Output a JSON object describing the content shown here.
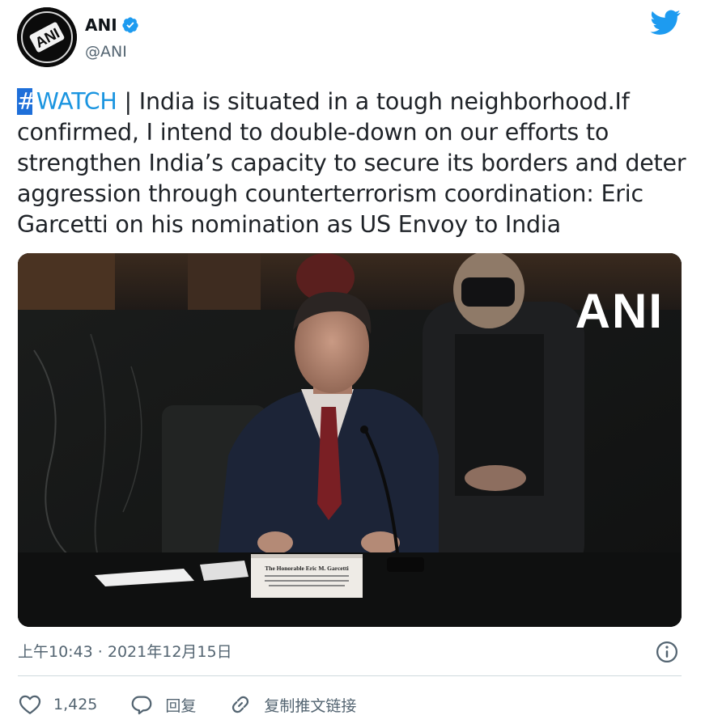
{
  "tweet": {
    "display_name": "ANI",
    "handle": "@ANI",
    "verified": true,
    "avatar_text": "ANI",
    "text": {
      "hashtag": "#WATCH",
      "body": " | India is situated in a tough neighborhood.If confirmed, I intend to double-down on our efforts to strengthen India’s capacity to secure its borders and deter aggression through counterterrorism coordination: Eric Garcetti on his nomination as US Envoy to India"
    },
    "media": {
      "watermark": "ANI",
      "nameplate": "The Honorable Eric M. Garcetti"
    },
    "timestamp": "上午10:43 · 2021年12月15日"
  },
  "actions": {
    "like_count": "1,425",
    "reply_label": "回复",
    "share_label": "复制推文链接"
  },
  "colors": {
    "brand": "#1d9bf0",
    "hashtag": "#1b95e0",
    "muted": "#536471",
    "divider": "#cfd9de"
  },
  "icons": [
    "verified-badge-icon",
    "twitter-bird-icon",
    "info-icon",
    "heart-icon",
    "reply-bubble-icon",
    "link-icon"
  ]
}
